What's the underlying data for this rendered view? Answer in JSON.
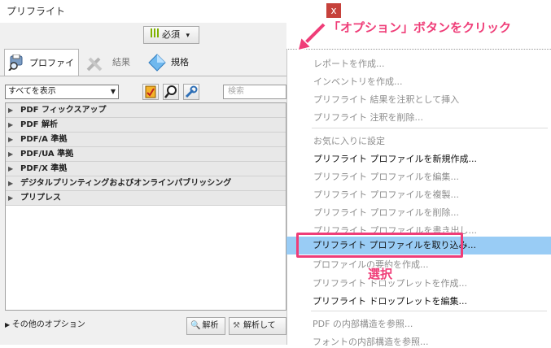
{
  "window": {
    "title": "プリフライト",
    "close_glyph": "x"
  },
  "toolbar": {
    "required_label": "必須",
    "required_dropdown": "▾"
  },
  "tabs": [
    {
      "label": "プロファイル",
      "active": true
    },
    {
      "label": "結果",
      "active": false
    },
    {
      "label": "規格",
      "active": false
    }
  ],
  "filter": {
    "selected": "すべてを表示",
    "search_placeholder": "検索"
  },
  "tree": {
    "items": [
      "PDF フィックスアップ",
      "PDF 解析",
      "PDF/A 準拠",
      "PDF/UA 準拠",
      "PDF/X 準拠",
      "デジタルプリンティングおよびオンラインパブリッシング",
      "プリプレス"
    ]
  },
  "footer": {
    "more_options": "その他のオプション",
    "analyze": "解析",
    "analyze_fix": "解析して"
  },
  "menu": {
    "items": [
      {
        "label": "レポートを作成...",
        "enabled": false
      },
      {
        "label": "インベントリを作成...",
        "enabled": false
      },
      {
        "label": "プリフライト 結果を注釈として挿入",
        "enabled": false
      },
      {
        "label": "プリフライト 注釈を削除...",
        "enabled": false
      },
      {
        "label": "お気に入りに設定",
        "enabled": false
      },
      {
        "label": "プリフライト プロファイルを新規作成...",
        "enabled": true
      },
      {
        "label": "プリフライト プロファイルを編集...",
        "enabled": false
      },
      {
        "label": "プリフライト プロファイルを複製...",
        "enabled": false
      },
      {
        "label": "プリフライト プロファイルを削除...",
        "enabled": false
      },
      {
        "label": "プリフライト プロファイルを書き出し...",
        "enabled": false
      },
      {
        "label": "プリフライト プロファイルを取り込み...",
        "enabled": true,
        "highlighted": true
      },
      {
        "label": "プロファイルの要約を作成...",
        "enabled": false
      },
      {
        "label": "プリフライト ドロップレットを作成...",
        "enabled": false
      },
      {
        "label": "プリフライト ドロップレットを編集...",
        "enabled": true
      },
      {
        "label": "PDF の内部構造を参照...",
        "enabled": false
      },
      {
        "label": "フォントの内部構造を参照...",
        "enabled": false
      }
    ]
  },
  "annotations": {
    "options_callout": "「オプション」ボタンをクリック",
    "select_callout": "選択",
    "color": "#ef3d78"
  }
}
